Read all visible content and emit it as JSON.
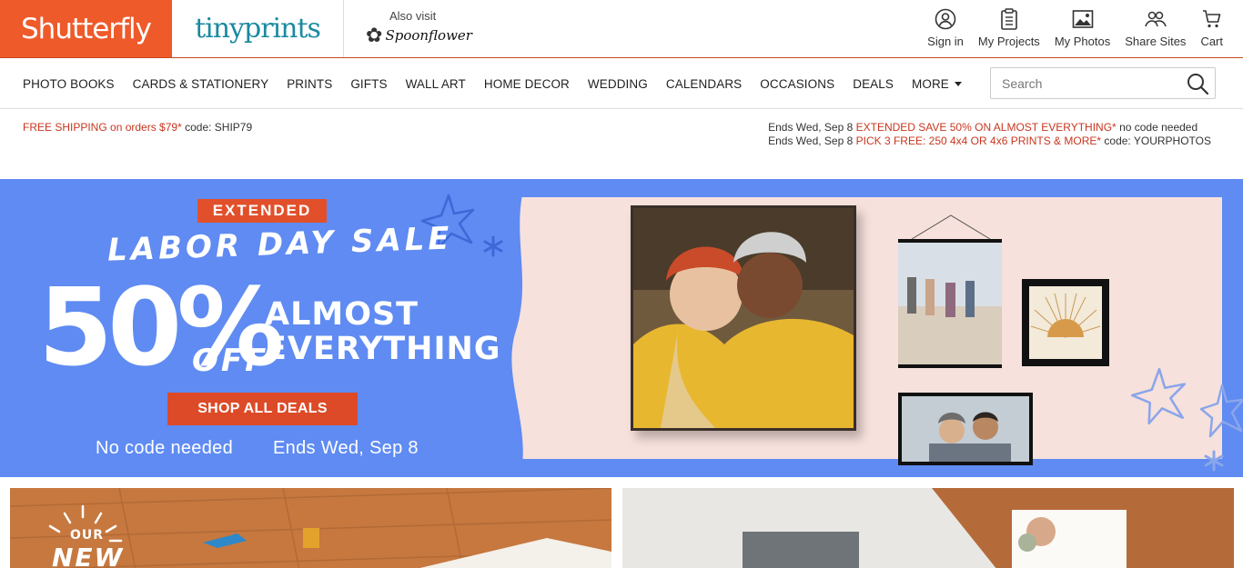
{
  "header": {
    "brand_primary": "Shutterfly",
    "brand_secondary": "tinyprints",
    "also_visit_label": "Also visit",
    "also_visit_brand": "Spoonflower",
    "utility_nav": [
      {
        "label": "Sign in",
        "icon": "user-circle-icon"
      },
      {
        "label": "My Projects",
        "icon": "clipboard-icon"
      },
      {
        "label": "My Photos",
        "icon": "image-icon"
      },
      {
        "label": "Share Sites",
        "icon": "people-icon"
      },
      {
        "label": "Cart",
        "icon": "cart-icon"
      }
    ]
  },
  "categories": [
    "PHOTO BOOKS",
    "CARDS & STATIONERY",
    "PRINTS",
    "GIFTS",
    "WALL ART",
    "HOME DECOR",
    "WEDDING",
    "CALENDARS",
    "OCCASIONS",
    "DEALS",
    "MORE"
  ],
  "search": {
    "placeholder": "Search",
    "value": ""
  },
  "promo": {
    "left_highlight": "FREE SHIPPING on orders $79*",
    "left_code": "code: SHIP79",
    "right_1_prefix": "Ends Wed, Sep 8",
    "right_1_highlight": "EXTENDED SAVE 50% ON ALMOST EVERYTHING*",
    "right_1_suffix": "no code needed",
    "right_2_prefix": "Ends Wed, Sep 8",
    "right_2_highlight": "PICK 3 FREE: 250 4x4 OR 4x6 PRINTS & MORE*",
    "right_2_suffix": "code: YOURPHOTOS"
  },
  "hero": {
    "tag": "EXTENDED",
    "headline": "LABOR DAY SALE",
    "big": "50%",
    "off": "OFF",
    "sub_line1": "ALMOST",
    "sub_line2": "EVERYTHING",
    "cta": "SHOP ALL DEALS",
    "no_code": "No code needed",
    "ends": "Ends Wed, Sep 8"
  },
  "tiles": {
    "left_line1": "OUR",
    "left_line2": "NEW"
  },
  "colors": {
    "brand_orange": "#ee5a2a",
    "tinyprints_teal": "#1a8aa0",
    "hero_blue": "#5f8bf2",
    "promo_red": "#c8361f",
    "cta_orange": "#dd4a27"
  }
}
